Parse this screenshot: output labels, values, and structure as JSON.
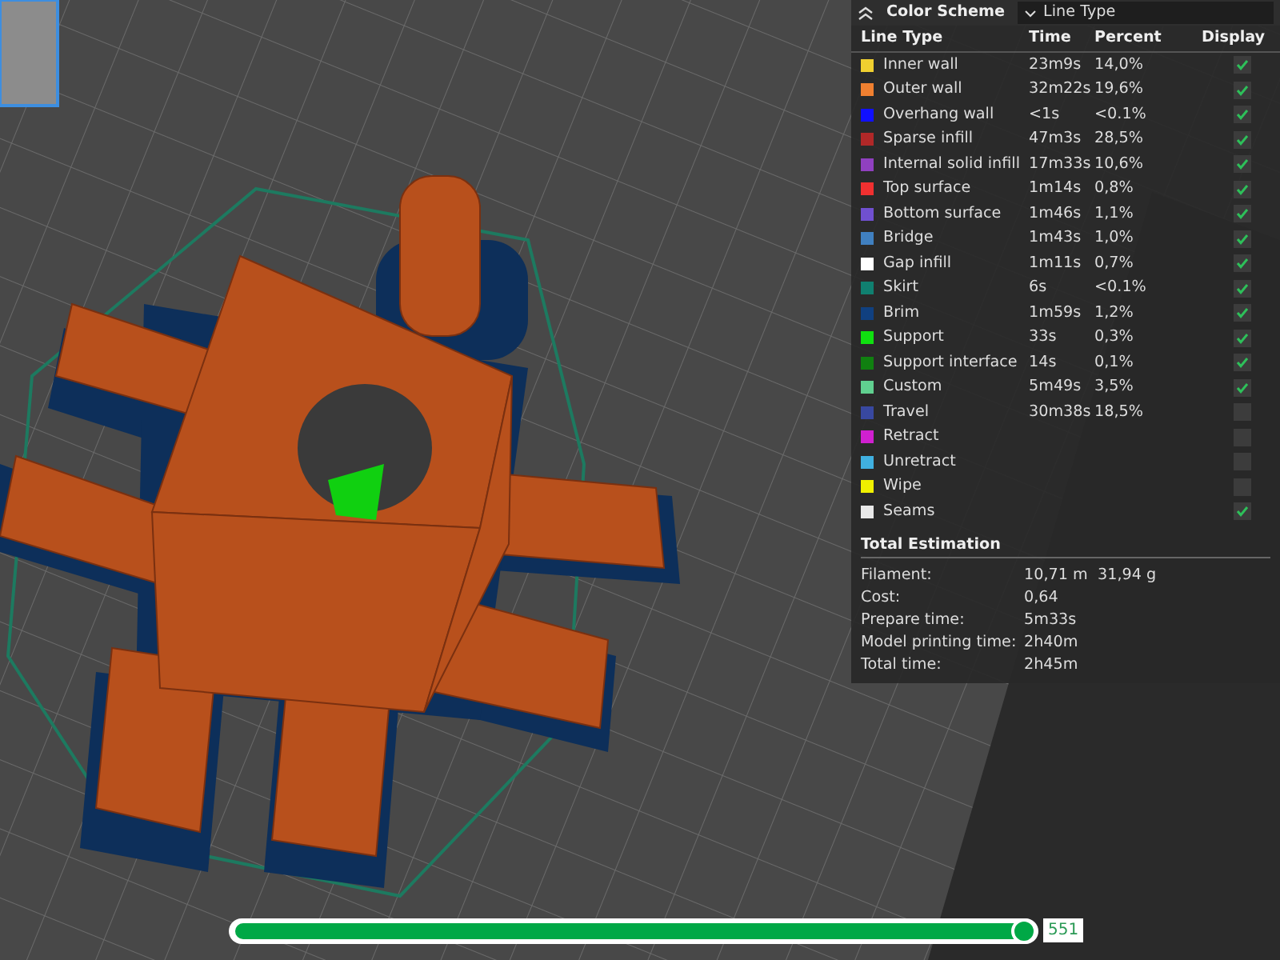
{
  "legend": {
    "title": "Color Scheme",
    "scheme": "Line Type",
    "columns": [
      "Line Type",
      "Time",
      "Percent",
      "Display"
    ],
    "rows": [
      {
        "name": "Inner wall",
        "color": "#f0d030",
        "time": "23m9s",
        "percent": "14,0%",
        "display": true
      },
      {
        "name": "Outer wall",
        "color": "#f08030",
        "time": "32m22s",
        "percent": "19,6%",
        "display": true
      },
      {
        "name": "Overhang wall",
        "color": "#1010ff",
        "time": "<1s",
        "percent": "<0.1%",
        "display": true
      },
      {
        "name": "Sparse infill",
        "color": "#b02828",
        "time": "47m3s",
        "percent": "28,5%",
        "display": true
      },
      {
        "name": "Internal solid infill",
        "color": "#9040c0",
        "time": "17m33s",
        "percent": "10,6%",
        "display": true
      },
      {
        "name": "Top surface",
        "color": "#f03030",
        "time": "1m14s",
        "percent": "0,8%",
        "display": true
      },
      {
        "name": "Bottom surface",
        "color": "#7050d0",
        "time": "1m46s",
        "percent": "1,1%",
        "display": true
      },
      {
        "name": "Bridge",
        "color": "#4080c0",
        "time": "1m43s",
        "percent": "1,0%",
        "display": true
      },
      {
        "name": "Gap infill",
        "color": "#ffffff",
        "time": "1m11s",
        "percent": "0,7%",
        "display": true
      },
      {
        "name": "Skirt",
        "color": "#108070",
        "time": "6s",
        "percent": "<0.1%",
        "display": true
      },
      {
        "name": "Brim",
        "color": "#104080",
        "time": "1m59s",
        "percent": "1,2%",
        "display": true
      },
      {
        "name": "Support",
        "color": "#10e010",
        "time": "33s",
        "percent": "0,3%",
        "display": true
      },
      {
        "name": "Support interface",
        "color": "#108010",
        "time": "14s",
        "percent": "0,1%",
        "display": true
      },
      {
        "name": "Custom",
        "color": "#60d090",
        "time": "5m49s",
        "percent": "3,5%",
        "display": true
      },
      {
        "name": "Travel",
        "color": "#3848a0",
        "time": "30m38s",
        "percent": "18,5%",
        "display": false
      },
      {
        "name": "Retract",
        "color": "#d020d0",
        "display": false
      },
      {
        "name": "Unretract",
        "color": "#40b0e0",
        "display": false
      },
      {
        "name": "Wipe",
        "color": "#f0f000",
        "display": false
      },
      {
        "name": "Seams",
        "color": "#e8e8e8",
        "display": true
      }
    ]
  },
  "estimation": {
    "title": "Total Estimation",
    "rows": [
      {
        "label": "Filament:",
        "values": [
          "10,71 m",
          "31,94 g"
        ]
      },
      {
        "label": "Cost:",
        "values": [
          "0,64"
        ]
      },
      {
        "label": "Prepare time:",
        "values": [
          "5m33s"
        ]
      },
      {
        "label": "Model printing time:",
        "values": [
          "2h40m"
        ]
      },
      {
        "label": "Total time:",
        "values": [
          "2h45m"
        ]
      }
    ]
  },
  "layer_slider": {
    "level": 0.99,
    "value": "551"
  }
}
